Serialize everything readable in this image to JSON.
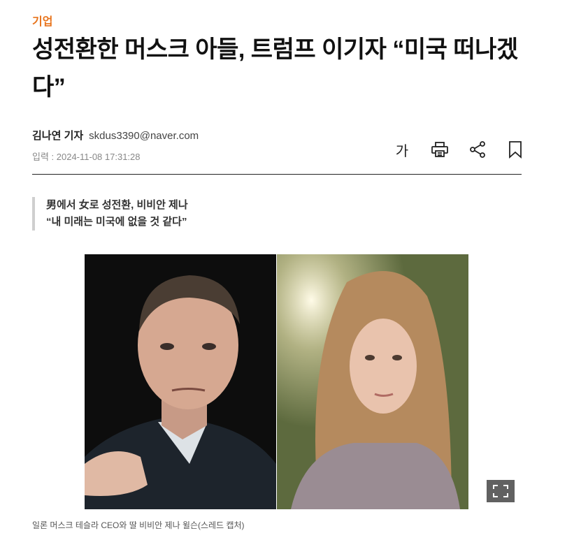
{
  "article": {
    "category": "기업",
    "headline": "성전환한 머스크 아들, 트럼프 이기자 “미국 떠나겠다”",
    "reporter_name": "김나연 기자",
    "reporter_email": "skdus3390@naver.com",
    "date": "입력 : 2024-11-08 17:31:28",
    "subtitle_lines": [
      "男에서 女로 성전환, 비비안 제나",
      "“내 미래는 미국에 없을 것 같다”"
    ],
    "photo_caption": "일론 머스크 테슬라 CEO와 딸 비비안 제나 윌슨(스레드 캡처)"
  },
  "tools": {
    "font_size_label": "가",
    "icons": [
      "font-size-icon",
      "print-icon",
      "share-icon",
      "bookmark-icon"
    ]
  },
  "colors": {
    "category": "#e8741c",
    "divider": "#222222",
    "quote_bar": "#cfcfcf"
  }
}
